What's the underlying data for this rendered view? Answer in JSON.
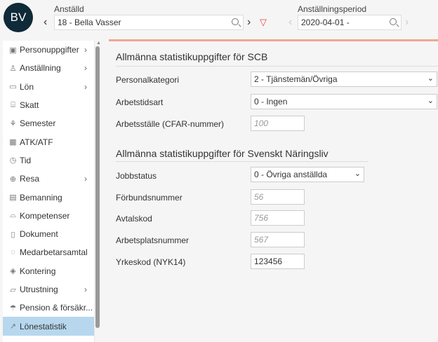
{
  "header": {
    "avatar_initials": "BV",
    "employee_label": "Anställd",
    "employee_value": "18 - Bella Vasser",
    "period_label": "Anställningsperiod",
    "period_value": "2020-04-01 -",
    "accent": "#efa792"
  },
  "sidebar": {
    "items": [
      {
        "label": "Personuppgifter",
        "icon": "id-card-icon",
        "sub": true
      },
      {
        "label": "Anställning",
        "icon": "person-icon",
        "sub": true
      },
      {
        "label": "Lön",
        "icon": "money-icon",
        "sub": true
      },
      {
        "label": "Skatt",
        "icon": "tax-icon",
        "sub": false
      },
      {
        "label": "Semester",
        "icon": "palm-icon",
        "sub": false
      },
      {
        "label": "ATK/ATF",
        "icon": "calendar-icon",
        "sub": false
      },
      {
        "label": "Tid",
        "icon": "clock-icon",
        "sub": false
      },
      {
        "label": "Resa",
        "icon": "globe-icon",
        "sub": true
      },
      {
        "label": "Bemanning",
        "icon": "schedule-icon",
        "sub": false
      },
      {
        "label": "Kompetenser",
        "icon": "graduation-icon",
        "sub": false
      },
      {
        "label": "Dokument",
        "icon": "document-icon",
        "sub": false
      },
      {
        "label": "Medarbetarsamtal",
        "icon": "chat-icon",
        "sub": false
      },
      {
        "label": "Kontering",
        "icon": "tag-icon",
        "sub": false
      },
      {
        "label": "Utrustning",
        "icon": "folder-icon",
        "sub": true
      },
      {
        "label": "Pension & försäkr...",
        "icon": "umbrella-icon",
        "sub": false
      },
      {
        "label": "Lönestatistik",
        "icon": "chart-icon",
        "sub": false,
        "active": true
      }
    ]
  },
  "scb": {
    "title": "Allmänna statistikuppgifter för SCB",
    "personalkategori_label": "Personalkategori",
    "personalkategori_value": "2 - Tjänstemän/Övriga",
    "arbetstidsart_label": "Arbetstidsart",
    "arbetstidsart_value": "0 - Ingen",
    "arbetsstalle_label": "Arbetsställe (CFAR-nummer)",
    "arbetsstalle_placeholder": "100"
  },
  "sn": {
    "title": "Allmänna statistikuppgifter för Svenskt Näringsliv",
    "jobbstatus_label": "Jobbstatus",
    "jobbstatus_value": "0 - Övriga anställda",
    "forbund_label": "Förbundsnummer",
    "forbund_placeholder": "56",
    "avtal_label": "Avtalskod",
    "avtal_placeholder": "756",
    "arbetsplats_label": "Arbetsplatsnummer",
    "arbetsplats_placeholder": "567",
    "yrkeskod_label": "Yrkeskod (NYK14)",
    "yrkeskod_value": "123456"
  }
}
